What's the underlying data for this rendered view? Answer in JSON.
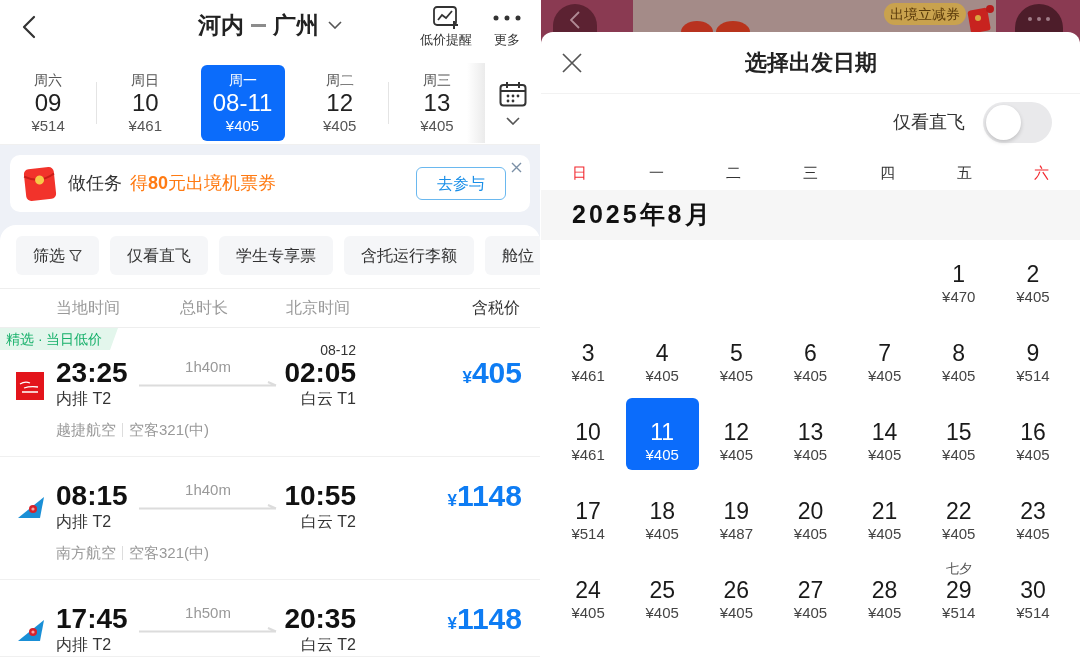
{
  "flight_list": {
    "header": {
      "origin": "河内",
      "destination": "广州"
    },
    "actions": [
      {
        "kind": "price_alert",
        "label": "低价提醒"
      },
      {
        "kind": "more",
        "label": "更多"
      }
    ],
    "date_tabs": [
      {
        "weekday": "周六",
        "date": "09",
        "price": "¥514",
        "selected": false
      },
      {
        "weekday": "周日",
        "date": "10",
        "price": "¥461",
        "selected": false
      },
      {
        "weekday": "周一",
        "date": "08-11",
        "price": "¥405",
        "selected": true
      },
      {
        "weekday": "周二",
        "date": "12",
        "price": "¥405",
        "selected": false
      },
      {
        "weekday": "周三",
        "date": "13",
        "price": "¥405",
        "selected": false
      }
    ],
    "promo": {
      "task": "做任务",
      "reward": "得**80**元出境机票券",
      "button": "去参与"
    },
    "filters": [
      {
        "label": "筛选",
        "kind": "filter"
      },
      {
        "label": "仅看直飞",
        "kind": "chip"
      },
      {
        "label": "学生专享票",
        "kind": "chip"
      },
      {
        "label": "含托运行李额",
        "kind": "chip"
      },
      {
        "label": "舱位",
        "kind": "chip"
      }
    ],
    "columns": [
      "当地时间",
      "总时长",
      "北京时间",
      "含税价"
    ],
    "flights": [
      {
        "kind": "square",
        "tag": "精选 · 当日低价",
        "depart_time": "23:25",
        "depart_airport": "内排 T2",
        "duration": "1h40m",
        "arrive_date": "08-12",
        "arrive_time": "02:05",
        "arrive_airport": "白云 T1",
        "currency": "¥",
        "price": "405",
        "airline": "越捷航空",
        "aircraft": "空客321(中)"
      },
      {
        "kind": "tail",
        "depart_time": "08:15",
        "depart_airport": "内排 T2",
        "duration": "1h40m",
        "arrive_time": "10:55",
        "arrive_airport": "白云 T2",
        "currency": "¥",
        "price": "1148",
        "airline": "南方航空",
        "aircraft": "空客321(中)"
      },
      {
        "kind": "tail",
        "depart_time": "17:45",
        "depart_airport": "内排 T2",
        "duration": "1h50m",
        "arrive_time": "20:35",
        "arrive_airport": "白云 T2",
        "currency": "¥",
        "price": "1148"
      }
    ]
  },
  "date_picker": {
    "backdrop": {
      "coupon_tag": "出境立减券"
    },
    "title": "选择出发日期",
    "direct_only": {
      "label": "仅看直飞",
      "on": false
    },
    "weekdays": [
      {
        "label": "日",
        "weekend": true
      },
      {
        "label": "一",
        "weekend": false
      },
      {
        "label": "二",
        "weekend": false
      },
      {
        "label": "三",
        "weekend": false
      },
      {
        "label": "四",
        "weekend": false
      },
      {
        "label": "五",
        "weekend": false
      },
      {
        "label": "六",
        "weekend": true
      }
    ],
    "month": "2025年8月",
    "weeks": [
      [
        {
          "day": "1",
          "price": "¥470",
          "selected": false
        },
        {
          "day": "2",
          "price": "¥405",
          "selected": false
        }
      ],
      [
        {
          "day": "3",
          "price": "¥461",
          "selected": false
        },
        {
          "day": "4",
          "price": "¥405",
          "selected": false
        },
        {
          "day": "5",
          "price": "¥405",
          "selected": false
        },
        {
          "day": "6",
          "price": "¥405",
          "selected": false
        },
        {
          "day": "7",
          "price": "¥405",
          "selected": false
        },
        {
          "day": "8",
          "price": "¥405",
          "selected": false
        },
        {
          "day": "9",
          "price": "¥514",
          "selected": false
        }
      ],
      [
        {
          "day": "10",
          "price": "¥461",
          "selected": false
        },
        {
          "day": "11",
          "price": "¥405",
          "selected": true
        },
        {
          "day": "12",
          "price": "¥405",
          "selected": false
        },
        {
          "day": "13",
          "price": "¥405",
          "selected": false
        },
        {
          "day": "14",
          "price": "¥405",
          "selected": false
        },
        {
          "day": "15",
          "price": "¥405",
          "selected": false
        },
        {
          "day": "16",
          "price": "¥405",
          "selected": false
        }
      ],
      [
        {
          "day": "17",
          "price": "¥514",
          "selected": false
        },
        {
          "day": "18",
          "price": "¥405",
          "selected": false
        },
        {
          "day": "19",
          "price": "¥487",
          "selected": false
        },
        {
          "day": "20",
          "price": "¥405",
          "selected": false
        },
        {
          "day": "21",
          "price": "¥405",
          "selected": false
        },
        {
          "day": "22",
          "price": "¥405",
          "selected": false
        },
        {
          "day": "23",
          "price": "¥405",
          "selected": false
        }
      ],
      [
        {
          "day": "24",
          "price": "¥405",
          "selected": false
        },
        {
          "day": "25",
          "price": "¥405",
          "selected": false
        },
        {
          "day": "26",
          "price": "¥405",
          "selected": false
        },
        {
          "day": "27",
          "price": "¥405",
          "selected": false
        },
        {
          "day": "28",
          "price": "¥405",
          "selected": false
        },
        {
          "day": "29",
          "price": "¥514",
          "selected": false,
          "festival": "七夕"
        },
        {
          "day": "30",
          "price": "¥514",
          "selected": false
        }
      ]
    ]
  }
}
